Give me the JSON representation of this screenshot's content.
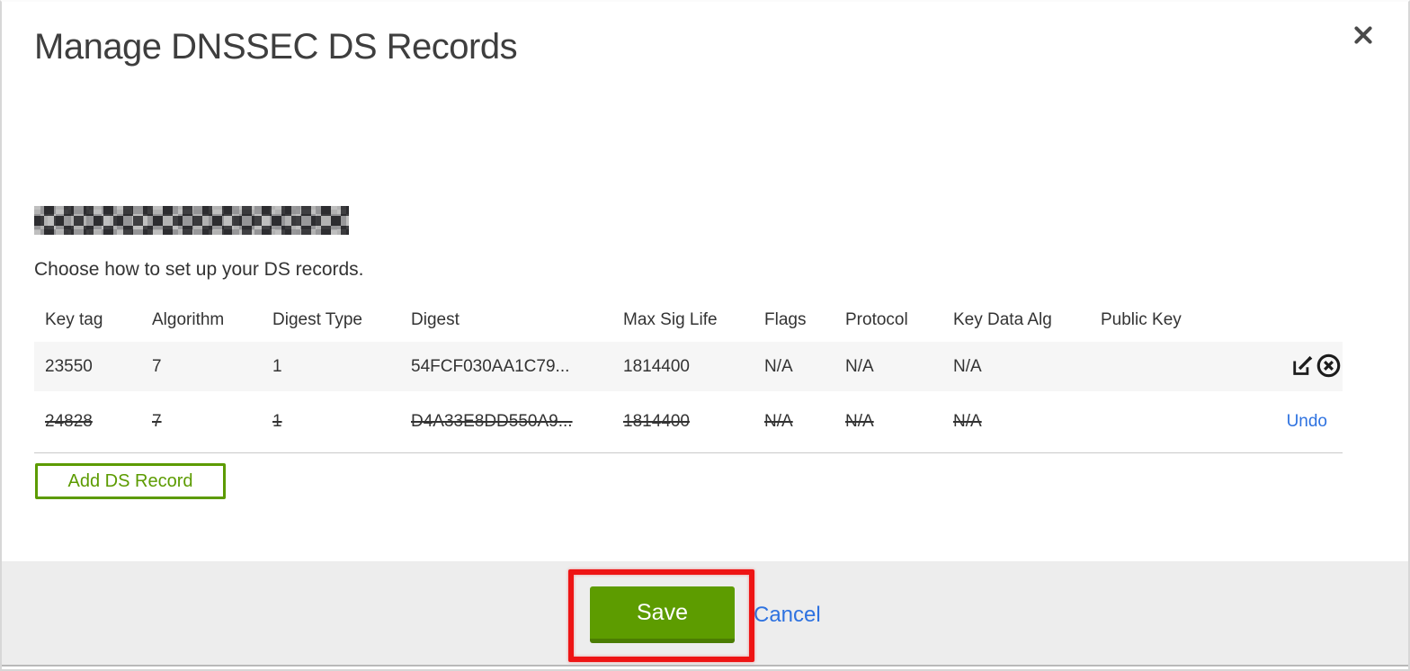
{
  "modal": {
    "title": "Manage DNSSEC DS Records",
    "subtitle": "Choose how to set up your DS records."
  },
  "table": {
    "columns": [
      "Key tag",
      "Algorithm",
      "Digest Type",
      "Digest",
      "Max Sig Life",
      "Flags",
      "Protocol",
      "Key Data Alg",
      "Public Key"
    ],
    "rows": [
      {
        "cells": [
          "23550",
          "7",
          "1",
          "54FCF030AA1C79...",
          "1814400",
          "N/A",
          "N/A",
          "N/A",
          ""
        ],
        "state": "normal"
      },
      {
        "cells": [
          "24828",
          "7",
          "1",
          "D4A33E8DD550A9...",
          "1814400",
          "N/A",
          "N/A",
          "N/A",
          ""
        ],
        "state": "pending-delete",
        "undo_label": "Undo"
      }
    ]
  },
  "buttons": {
    "add_ds_record": "Add DS Record",
    "save": "Save",
    "cancel": "Cancel"
  },
  "icons": {
    "close": "close-icon",
    "edit": "edit-icon",
    "delete": "delete-circle-icon"
  },
  "colors": {
    "accent_green": "#5d9c00",
    "accent_green_dark": "#4b7d02",
    "link_blue": "#2e72e0",
    "annotation_red": "#ee1414",
    "row_alt_bg": "#f6f6f6",
    "footer_bg": "#ededed"
  }
}
